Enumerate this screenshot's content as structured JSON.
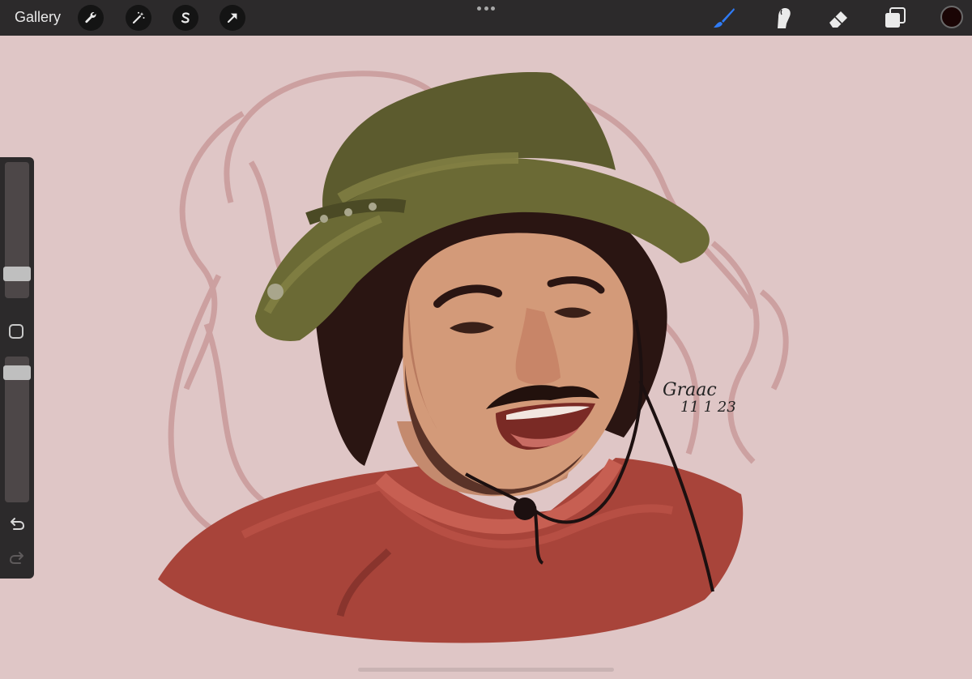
{
  "toolbar": {
    "gallery_label": "Gallery",
    "left_tools": [
      {
        "name": "actions",
        "icon": "wrench-icon"
      },
      {
        "name": "adjustments",
        "icon": "magic-wand-icon"
      },
      {
        "name": "selection",
        "icon": "selection-s-icon"
      },
      {
        "name": "transform",
        "icon": "arrow-cursor-icon"
      }
    ],
    "right_tools": [
      {
        "name": "brush",
        "icon": "brush-icon",
        "active": true
      },
      {
        "name": "smudge",
        "icon": "smudge-finger-icon",
        "active": false
      },
      {
        "name": "eraser",
        "icon": "eraser-icon",
        "active": false
      },
      {
        "name": "layers",
        "icon": "layers-icon",
        "active": false
      }
    ],
    "current_color": "#1a0505",
    "accent_color": "#2f7bf5"
  },
  "sidebar": {
    "brush_size_fraction": 0.18,
    "opacity_fraction": 0.88,
    "modify_icon": "square-modify-icon",
    "undo_icon": "undo-icon",
    "redo_icon": "redo-icon"
  },
  "artwork": {
    "signature_text": "Graac",
    "signature_date": "11 1 23",
    "background_color": "#dfc6c6"
  }
}
